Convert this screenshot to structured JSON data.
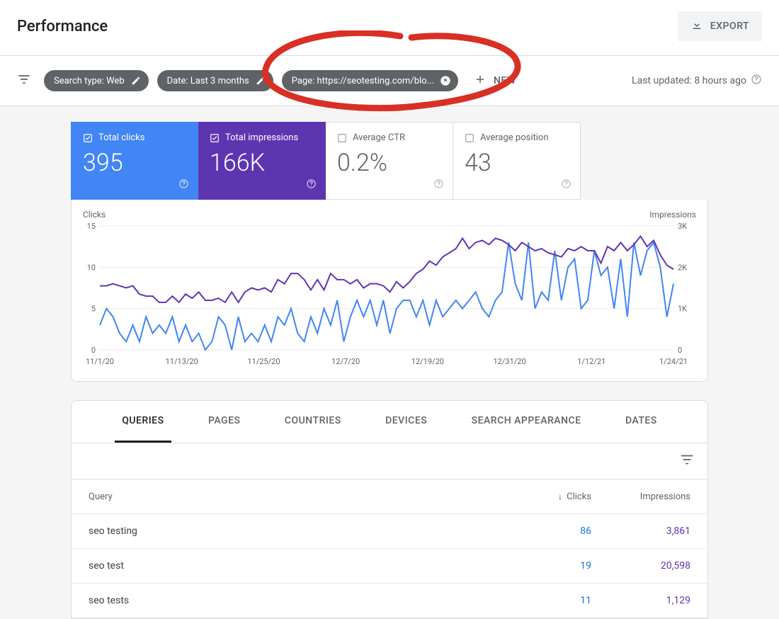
{
  "header": {
    "title": "Performance",
    "export_label": "EXPORT"
  },
  "filters": {
    "search_type": "Search type: Web",
    "date": "Date: Last 3 months",
    "page": "Page: https://seotesting.com/blo...",
    "new_label": "NEW",
    "last_updated": "Last updated: 8 hours ago"
  },
  "metrics": {
    "clicks": {
      "label": "Total clicks",
      "value": "395"
    },
    "impressions": {
      "label": "Total impressions",
      "value": "166K"
    },
    "ctr": {
      "label": "Average CTR",
      "value": "0.2%"
    },
    "position": {
      "label": "Average position",
      "value": "43"
    }
  },
  "chart_data": {
    "type": "line",
    "x_dates": [
      "11/1/20",
      "11/13/20",
      "11/25/20",
      "12/7/20",
      "12/19/20",
      "12/31/20",
      "1/12/21",
      "1/24/21"
    ],
    "clicks_label": "Clicks",
    "impressions_label": "Impressions",
    "clicks_axis": {
      "min": 0,
      "max": 15,
      "ticks": [
        0,
        5,
        10,
        15
      ]
    },
    "impressions_axis": {
      "min": 0,
      "max": 3000,
      "ticks": [
        0,
        1000,
        2000,
        3000
      ],
      "tick_labels": [
        "0",
        "1K",
        "2K",
        "3K"
      ]
    },
    "series": [
      {
        "name": "Clicks",
        "axis": "left",
        "color": "#4285f4",
        "values": [
          3,
          5,
          4,
          2,
          1,
          3,
          1,
          4,
          2,
          3,
          2,
          4,
          1,
          3,
          1,
          2,
          0,
          1,
          4,
          3,
          0,
          4,
          1,
          2,
          1,
          3,
          1,
          4,
          3,
          5,
          2,
          1,
          4,
          2,
          5,
          3,
          6,
          1,
          4,
          6,
          4,
          6,
          3,
          6,
          2,
          5,
          6,
          6,
          4,
          6,
          3,
          6,
          4,
          5,
          6,
          5,
          6,
          7,
          5,
          4,
          6,
          7,
          13,
          8,
          6,
          13,
          5,
          7,
          6,
          12,
          6,
          10,
          11,
          5,
          6,
          12,
          9,
          10,
          5,
          11,
          4,
          13,
          9,
          12,
          13,
          10,
          4,
          8
        ]
      },
      {
        "name": "Impressions",
        "axis": "right",
        "color": "#5e35b1",
        "values": [
          1550,
          1550,
          1600,
          1550,
          1500,
          1550,
          1350,
          1300,
          1300,
          1150,
          1150,
          1300,
          1150,
          1350,
          1250,
          1400,
          1200,
          1200,
          1250,
          1150,
          1400,
          1150,
          1400,
          1500,
          1450,
          1500,
          1400,
          1700,
          1600,
          1850,
          1850,
          1700,
          1450,
          1700,
          1450,
          1850,
          1700,
          1700,
          1600,
          1700,
          1500,
          1600,
          1600,
          1550,
          1400,
          1650,
          1500,
          1650,
          1850,
          1950,
          2150,
          2050,
          2250,
          2350,
          2450,
          2700,
          2450,
          2600,
          2650,
          2550,
          2700,
          2650,
          2550,
          2400,
          2600,
          2500,
          2400,
          2450,
          2350,
          2300,
          2250,
          2450,
          2400,
          2500,
          2400,
          2400,
          2100,
          2500,
          2400,
          2600,
          2400,
          2550,
          2750,
          2500,
          2650,
          2300,
          2050,
          1950
        ]
      }
    ]
  },
  "tabs": {
    "queries": "QUERIES",
    "pages": "PAGES",
    "countries": "COUNTRIES",
    "devices": "DEVICES",
    "search_appearance": "SEARCH APPEARANCE",
    "dates": "DATES"
  },
  "table": {
    "head_query": "Query",
    "head_clicks": "Clicks",
    "head_impressions": "Impressions",
    "rows": [
      {
        "query": "seo testing",
        "clicks": "86",
        "impressions": "3,861"
      },
      {
        "query": "seo test",
        "clicks": "19",
        "impressions": "20,598"
      },
      {
        "query": "seo tests",
        "clicks": "11",
        "impressions": "1,129"
      }
    ]
  }
}
